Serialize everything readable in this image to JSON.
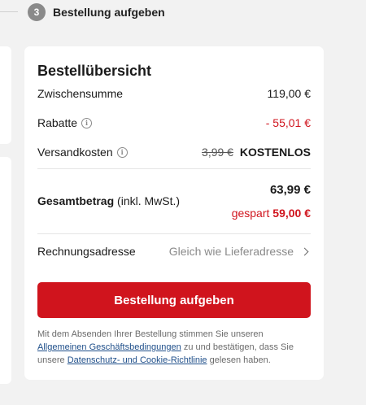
{
  "step": {
    "number": "3",
    "label": "Bestellung aufgeben"
  },
  "summary": {
    "title": "Bestellübersicht",
    "subtotal_label": "Zwischensumme",
    "subtotal_value": "119,00 €",
    "discount_label": "Rabatte",
    "discount_value": "- 55,01 €",
    "shipping_label": "Versandkosten",
    "shipping_old": "3,99 €",
    "shipping_value": "KOSTENLOS",
    "total_label": "Gesamtbetrag",
    "total_suffix": "(inkl. MwSt.)",
    "total_value": "63,99 €",
    "saved_label": "gespart",
    "saved_value": "59,00 €",
    "address_label": "Rechnungsadresse",
    "address_value": "Gleich wie Lieferadresse",
    "order_button": "Bestellung aufgeben"
  },
  "legal": {
    "part1": "Mit dem Absenden Ihrer Bestellung stimmen Sie unseren",
    "link1": "Allgemeinen Geschäftsbedingungen",
    "part2": "zu und bestätigen, dass Sie unsere",
    "link2": "Datenschutz- und Cookie-Richtlinie",
    "part3": "gelesen haben."
  },
  "colors": {
    "accent": "#d0141d",
    "link": "#1f4f8a",
    "background": "#f2f2f2"
  },
  "icons": {
    "info": "info-icon",
    "chevron": "chevron-right-icon"
  }
}
